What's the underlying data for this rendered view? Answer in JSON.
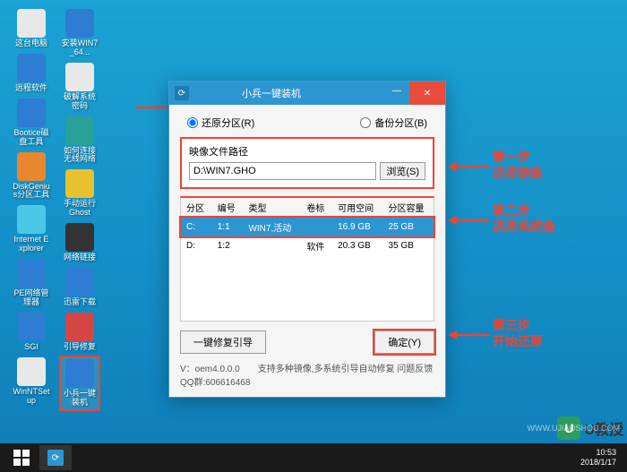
{
  "desktop_icons": [
    {
      "name": "this-pc",
      "label": "这台电脑",
      "ico": "ic-white"
    },
    {
      "name": "remote-software",
      "label": "远程软件",
      "ico": "ic-blue"
    },
    {
      "name": "bootice-disk",
      "label": "Bootice磁盘工具",
      "ico": "ic-blue"
    },
    {
      "name": "diskgenius",
      "label": "DiskGenius分区工具",
      "ico": "ic-orange"
    },
    {
      "name": "internet-explorer",
      "label": "Internet Explorer",
      "ico": "ic-cyan"
    },
    {
      "name": "pe-network-manager",
      "label": "PE网络管理器",
      "ico": "ic-blue"
    },
    {
      "name": "sgi",
      "label": "SGI",
      "ico": "ic-blue"
    },
    {
      "name": "winntsetup",
      "label": "WinNTSetup",
      "ico": "ic-white"
    },
    {
      "name": "install",
      "label": "安装WIN7_64...",
      "ico": "ic-blue"
    },
    {
      "name": "crack-password",
      "label": "破解系统密码",
      "ico": "ic-white"
    },
    {
      "name": "wireless-connect",
      "label": "如何连接无线网络",
      "ico": "ic-teal"
    },
    {
      "name": "ghost-manual",
      "label": "手动运行Ghost",
      "ico": "ic-yellow"
    },
    {
      "name": "network-links",
      "label": "网络链接",
      "ico": "ic-dark"
    },
    {
      "name": "xunlei",
      "label": "迅雷下载",
      "ico": "ic-blue"
    },
    {
      "name": "boot-repair",
      "label": "引导修复",
      "ico": "ic-red"
    },
    {
      "name": "xiaobing-installer",
      "label": "小兵一键装机",
      "ico": "ic-blue",
      "highlight": true
    }
  ],
  "window": {
    "title": "小兵一键装机",
    "radio_restore": "还原分区(R)",
    "radio_backup": "备份分区(B)",
    "path_label": "映像文件路径",
    "path_value": "D:\\WIN7.GHO",
    "browse_btn": "浏览(S)",
    "table": {
      "headers": [
        "分区",
        "编号",
        "类型",
        "卷标",
        "可用空间",
        "分区容量"
      ],
      "rows": [
        {
          "p": "C:",
          "n": "1:1",
          "t": "WIN7,活动",
          "v": "",
          "free": "16.9 GB",
          "cap": "25 GB",
          "selected": true
        },
        {
          "p": "D:",
          "n": "1:2",
          "t": "",
          "v": "软件",
          "free": "20.3 GB",
          "cap": "35 GB",
          "selected": false
        }
      ]
    },
    "repair_btn": "一键修复引导",
    "ok_btn": "确定(Y)",
    "status": "V：oem4.0.0.0　　支持多种镜像,多系统引导自动修复 问题反馈QQ群:606616468"
  },
  "annotations": {
    "step1_title": "第一步",
    "step1_sub": "选择镜像",
    "step2_title": "第二步",
    "step2_sub": "选择系统盘",
    "step3_title": "第三步",
    "step3_sub": "开始还原"
  },
  "taskbar": {
    "time": "10:53",
    "date": "2018/1/17"
  },
  "watermark": {
    "text": "U教授",
    "url": "WWW.UJIAOSHOU.COM"
  }
}
